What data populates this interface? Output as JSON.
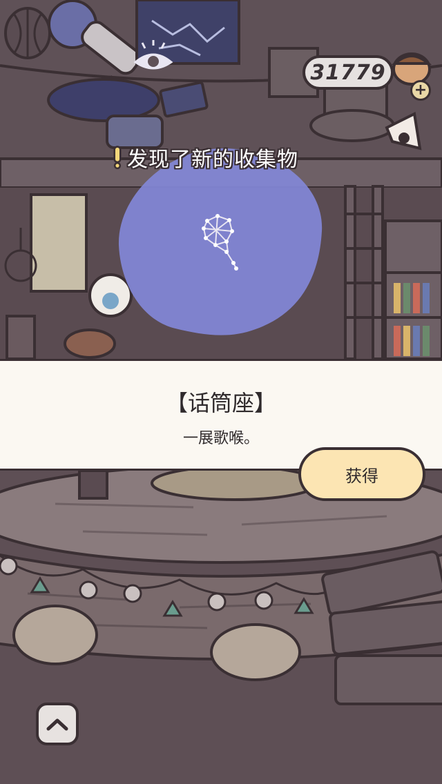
{
  "hud": {
    "currency_value": "31779"
  },
  "notification": {
    "text": "发现了新的收集物"
  },
  "reward": {
    "title": "【话筒座】",
    "description": "一展歌喉。",
    "obtain_label": "获得"
  },
  "icons": {
    "plus": "plus-icon",
    "up": "chevron-up-icon",
    "eye": "eye-icon",
    "constellation": "microphone-constellation-icon",
    "exclamation": "exclamation-icon",
    "gift": "gift-box-icon",
    "acorn": "acorn-icon",
    "megaphone": "megaphone-icon"
  },
  "colors": {
    "background": "#5e4f55",
    "outline": "#3a2f33",
    "panel": "#fbf8f2",
    "button": "#fce5b3",
    "blob": "#8287d6"
  }
}
